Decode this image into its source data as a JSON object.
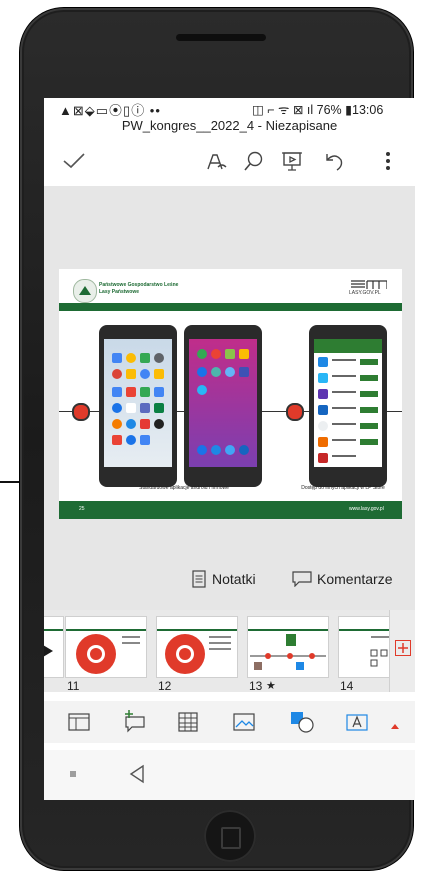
{
  "status_bar": {
    "left_icons": "▲⊠⬙▭⦿▯ⓘ ••",
    "battery": "76%",
    "time": "13:06"
  },
  "document": {
    "title": "PW_kongres__2022_4 - Niezapisane"
  },
  "toolbar": {
    "done_icon": "checkmark-icon",
    "pen_icon": "pen-icon",
    "search_icon": "search-icon",
    "present_icon": "present-icon",
    "undo_icon": "undo-icon",
    "more_icon": "more-vertical-icon"
  },
  "slide": {
    "org_name_line1": "Państwowe Gospodarstwo Leśne",
    "org_name_line2": "Lasy Państwowe",
    "brand_logo_text": "LASY.GOV.PL",
    "caption_left": "Standardowe aplikacje android i firmowe",
    "caption_right": "Dostęp do innych aplikacji w LP Store",
    "footer_page": "25",
    "footer_url": "www.lasy.gov.pl",
    "accent_green": "#1e6b34"
  },
  "panel_actions": {
    "notes_label": "Notatki",
    "comments_label": "Komentarze"
  },
  "thumbnails": [
    {
      "number": "11"
    },
    {
      "number": "12"
    },
    {
      "number": "13",
      "badge": "★"
    },
    {
      "number": "14"
    }
  ],
  "insert_bar": {
    "icons": [
      "layout-icon",
      "comment-icon",
      "table-icon",
      "image-icon",
      "shapes-icon",
      "textbox-icon",
      "expand-up-icon"
    ]
  },
  "nav_bar": {
    "recents_icon": "recents-icon",
    "back_icon": "back-icon"
  },
  "colors": {
    "accent_red": "#e03a2a",
    "canvas_gray": "#e6e6e6"
  }
}
